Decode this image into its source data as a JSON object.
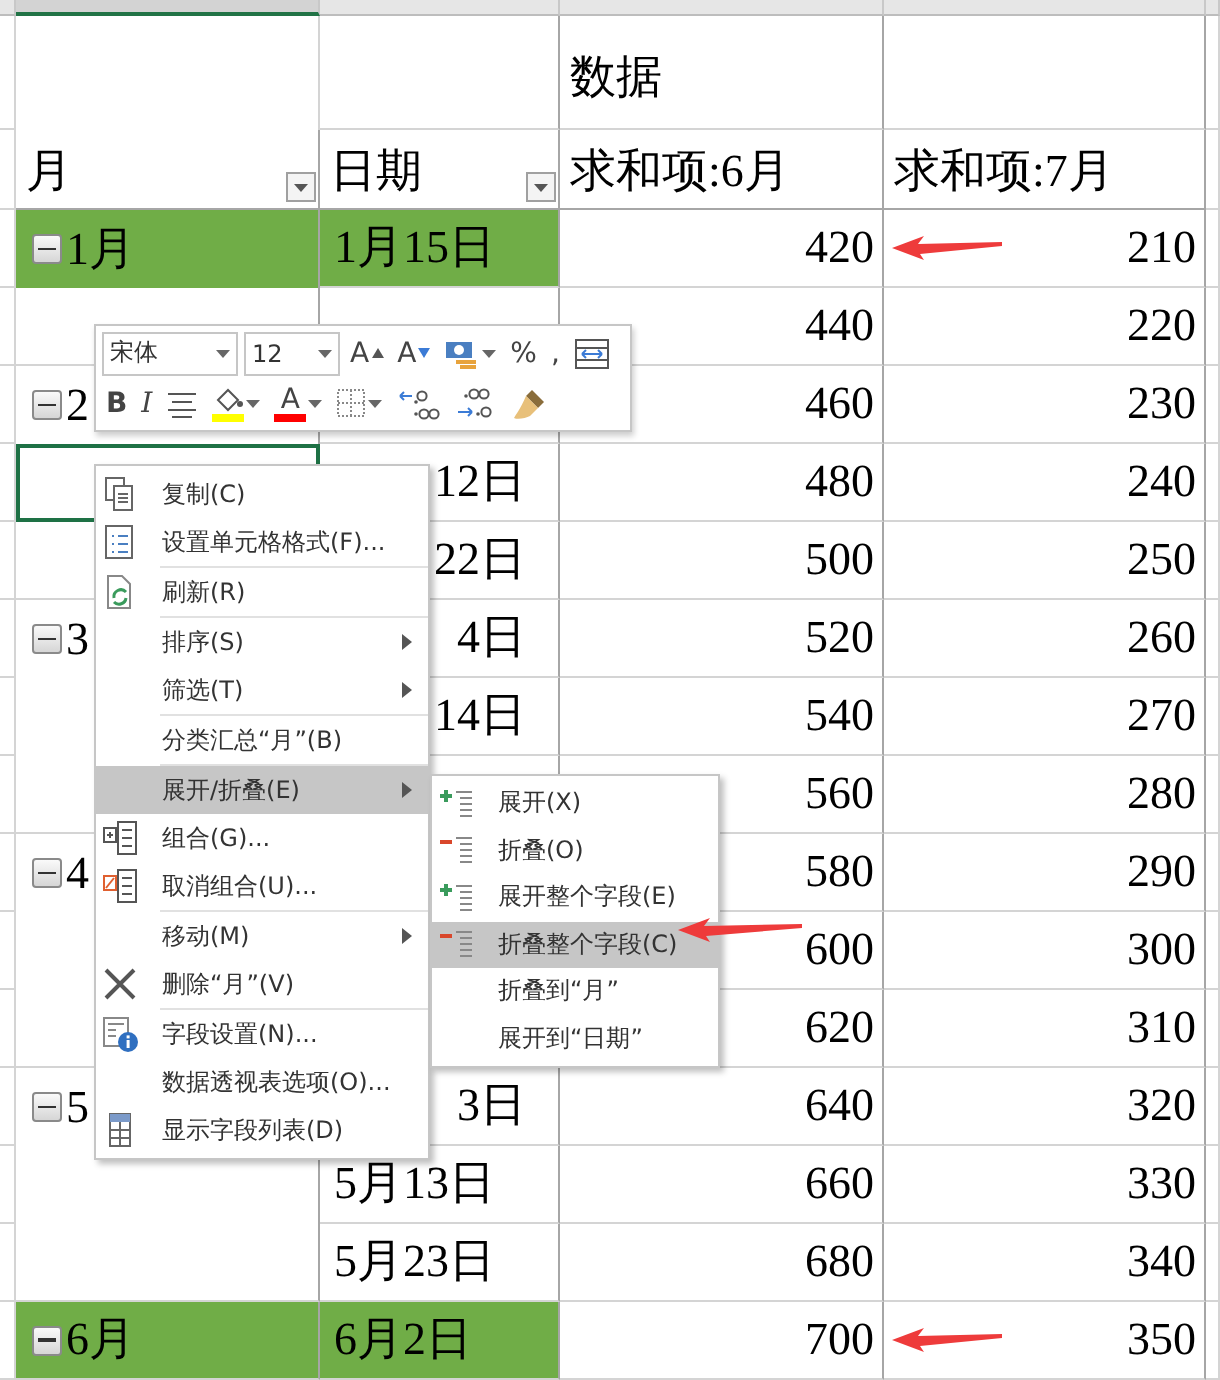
{
  "column_strip": [
    {
      "selected": true
    },
    {
      "selected": false
    },
    {
      "selected": false
    },
    {
      "selected": false
    }
  ],
  "pivot": {
    "data_label": "数据",
    "headers": [
      {
        "text": "月",
        "filter": true
      },
      {
        "text": "日期",
        "filter": true
      },
      {
        "text": "求和项:6月",
        "filter": false
      },
      {
        "text": "求和项:7月",
        "filter": false
      }
    ],
    "rows": [
      {
        "month": "1月",
        "date": "1月15日",
        "june": "420",
        "july": "210",
        "highlighted": true,
        "selected": false,
        "arrow": true
      },
      {
        "june": "440",
        "july": "220",
        "highlighted": false,
        "selected": false,
        "arrow": false
      },
      {
        "month": "2",
        "june": "460",
        "july": "230",
        "highlighted": false,
        "selected": false,
        "arrow": false
      },
      {
        "date": "12日",
        "date_cut": true,
        "june": "480",
        "july": "240",
        "highlighted": false,
        "selected": true,
        "arrow": false
      },
      {
        "date": "22日",
        "date_cut": true,
        "june": "500",
        "july": "250",
        "highlighted": false,
        "selected": false,
        "arrow": false
      },
      {
        "month": "3",
        "date": "4日",
        "date_cut": true,
        "june": "520",
        "july": "260",
        "highlighted": false,
        "selected": false,
        "arrow": false
      },
      {
        "date": "14日",
        "date_cut": true,
        "june": "540",
        "july": "270",
        "highlighted": false,
        "selected": false,
        "arrow": false
      },
      {
        "june": "560",
        "july": "280",
        "highlighted": false,
        "selected": false,
        "arrow": false
      },
      {
        "month": "4",
        "june": "580",
        "july": "290",
        "highlighted": false,
        "selected": false,
        "arrow": false
      },
      {
        "june": "600",
        "july": "300",
        "highlighted": false,
        "selected": false,
        "arrow": false
      },
      {
        "june": "620",
        "july": "310",
        "highlighted": false,
        "selected": false,
        "arrow": false
      },
      {
        "month": "5",
        "date": "3日",
        "date_cut": true,
        "june": "640",
        "july": "320",
        "highlighted": false,
        "selected": false,
        "arrow": false
      },
      {
        "date": "5月13日",
        "date_cut": false,
        "june": "660",
        "july": "330",
        "highlighted": false,
        "selected": false,
        "arrow": false
      },
      {
        "date": "5月23日",
        "date_cut": false,
        "june": "680",
        "july": "340",
        "highlighted": false,
        "selected": false,
        "arrow": false
      },
      {
        "month": "6月",
        "date": "6月2日",
        "date_cut": false,
        "june": "700",
        "july": "350",
        "highlighted": true,
        "selected": false,
        "arrow": true
      }
    ]
  },
  "mini_toolbar": {
    "font": "宋体",
    "size": "12",
    "row1": [
      {
        "kind": "grow-font",
        "label": "A"
      },
      {
        "kind": "shrink-font",
        "label": "A"
      },
      {
        "kind": "accounting",
        "dropdown": true
      },
      {
        "kind": "text",
        "label": "%"
      },
      {
        "kind": "text",
        "label": ","
      },
      {
        "kind": "merge"
      }
    ],
    "row2": [
      {
        "kind": "bold",
        "label": "B"
      },
      {
        "kind": "italic",
        "label": "I"
      },
      {
        "kind": "center"
      },
      {
        "kind": "fill-color",
        "color": "#ffff00",
        "dropdown": true
      },
      {
        "kind": "font-color",
        "label": "A",
        "color": "#ff0000",
        "dropdown": true
      },
      {
        "kind": "borders",
        "dropdown": true
      },
      {
        "kind": "increase-decimal"
      },
      {
        "kind": "decrease-decimal"
      },
      {
        "kind": "format-painter"
      }
    ]
  },
  "context_menu": [
    {
      "kind": "copy",
      "label": "复制(C)",
      "submenu": false,
      "selected": false
    },
    {
      "kind": "format-cells",
      "label": "设置单元格格式(F)...",
      "submenu": false,
      "selected": false
    },
    {
      "kind": "separator"
    },
    {
      "kind": "refresh",
      "label": "刷新(R)",
      "submenu": false,
      "selected": false
    },
    {
      "kind": "separator"
    },
    {
      "kind": "plain",
      "label": "排序(S)",
      "submenu": true,
      "selected": false
    },
    {
      "kind": "plain",
      "label": "筛选(T)",
      "submenu": true,
      "selected": false
    },
    {
      "kind": "separator"
    },
    {
      "kind": "plain",
      "label": "分类汇总“月”(B)",
      "submenu": false,
      "selected": false
    },
    {
      "kind": "separator"
    },
    {
      "kind": "plain",
      "label": "展开/折叠(E)",
      "submenu": true,
      "selected": true
    },
    {
      "kind": "group",
      "label": "组合(G)...",
      "submenu": false,
      "selected": false
    },
    {
      "kind": "ungroup",
      "label": "取消组合(U)...",
      "submenu": false,
      "selected": false
    },
    {
      "kind": "separator"
    },
    {
      "kind": "plain",
      "label": "移动(M)",
      "submenu": true,
      "selected": false
    },
    {
      "kind": "delete",
      "label": "删除“月”(V)",
      "submenu": false,
      "selected": false
    },
    {
      "kind": "separator"
    },
    {
      "kind": "field-settings",
      "label": "字段设置(N)...",
      "submenu": false,
      "selected": false
    },
    {
      "kind": "plain",
      "label": "数据透视表选项(O)...",
      "submenu": false,
      "selected": false
    },
    {
      "kind": "field-list",
      "label": "显示字段列表(D)",
      "submenu": false,
      "selected": false
    }
  ],
  "submenu": [
    {
      "kind": "expand",
      "label": "展开(X)",
      "selected": false,
      "arrow": false
    },
    {
      "kind": "collapse",
      "label": "折叠(O)",
      "selected": false,
      "arrow": false
    },
    {
      "kind": "expand",
      "label": "展开整个字段(E)",
      "selected": false,
      "arrow": false
    },
    {
      "kind": "collapse",
      "label": "折叠整个字段(C)",
      "selected": true,
      "arrow": true
    },
    {
      "kind": "plain",
      "label": "折叠到“月”",
      "selected": false,
      "arrow": false
    },
    {
      "kind": "plain",
      "label": "展开到“日期”",
      "selected": false,
      "arrow": false
    }
  ]
}
